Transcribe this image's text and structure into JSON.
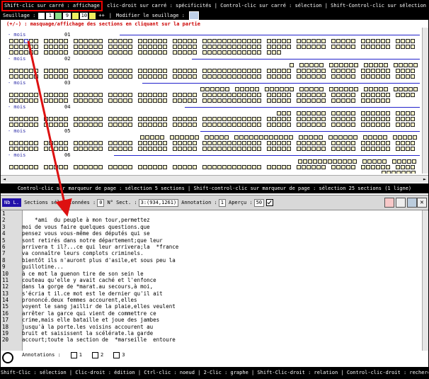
{
  "top_bar": {
    "highlighted": "Shift-clic sur carré : affichage",
    "rest": "clic-droit sur carré : spécificités | Control-clic sur carré : sélection | Shift-Control-clic sur sélection : desélection"
  },
  "seuillage": {
    "label": "Seuillage :",
    "v1": "1",
    "v2": "9",
    "v3": "10",
    "arrows": "++",
    "sep": "|",
    "modify": "Modifier le seuillage :",
    "box_colors": [
      "#ffffff",
      "#8ce08c",
      "#f0f060"
    ]
  },
  "hint": "(+/-) : masquage/affichage des sections en cliquant sur la partie",
  "months": [
    {
      "label": "- mois",
      "num": "01"
    },
    {
      "label": "- mois",
      "num": "02"
    },
    {
      "label": "- mois",
      "num": "03"
    },
    {
      "label": "- mois",
      "num": "04"
    },
    {
      "label": "- mois",
      "num": "05"
    },
    {
      "label": "- mois",
      "num": "06"
    }
  ],
  "mid_bar": "Control-clic sur marqueur de page : sélection 5 sections | Shift-control-clic sur marqueur de page : sélection 25 sections (1 ligne)",
  "toolbar": {
    "nb_l": "Nb L.",
    "sections_label": "Sections sélectionnées :",
    "sections_val": "0",
    "nsect_label": "N° Sect. :",
    "nsect_val": "3:(934,1261)",
    "annot_label": "Annotation :",
    "annot_val": "1",
    "apercu_label": "Aperçu :",
    "apercu_val": "50"
  },
  "line_numbers": [
    "1",
    "2",
    "3",
    "4",
    "5",
    "6",
    "7",
    "8",
    "9",
    "10",
    "11",
    "12",
    "13",
    "14",
    "15",
    "16",
    "17",
    "18",
    "19",
    "20"
  ],
  "text_lines": [
    "",
    "    *ami  du peuple à mon tour,permettez",
    "moi de vous faire quelques questions.que",
    "pensez vous vous-même des députés qui se",
    "sont retirés dans notre département;que leur",
    "arrivera t il?...ce qui leur arrivera;la  *france",
    "va connaître leurs complots criminels.",
    "bientôt ils n'auront plus d'asile,et sous peu la",
    "guillotine...",
    "à ce mot la guenon tire de son sein le",
    "couteau qu'elle y avait caché et l'enfonce",
    "dans la gorge de *marat.au secours,à moi,",
    "s'écria t il.ce mot est le dernier qu'il ait",
    "prononcé.deux femmes accourent,elles",
    "voyent le sang jaillir de la plaie,elles veulent",
    "arrêter la garce qui vient de commettre ce",
    "crime,mais elle bataille et joue des jambes",
    "jusqu'à la porte.les voisins accourent au",
    "bruit et saisissent la scélérate.la garde",
    "accourt;toute la section de  *marseille  entoure"
  ],
  "annotations": {
    "label": "Annotations :",
    "opts": [
      "1",
      "2",
      "3"
    ]
  },
  "bottom_bar": "Shift-Clic : sélection | Clic-droit : édition | Ctrl-clic : noeud | 2-Clic : graphe | Shift-Clic-droit : relation | Control-clic-droit : recherche relation",
  "colors": {
    "accent": "#2222aa",
    "arrow": "#dd1111",
    "square_fill": "#f6f2c8"
  }
}
